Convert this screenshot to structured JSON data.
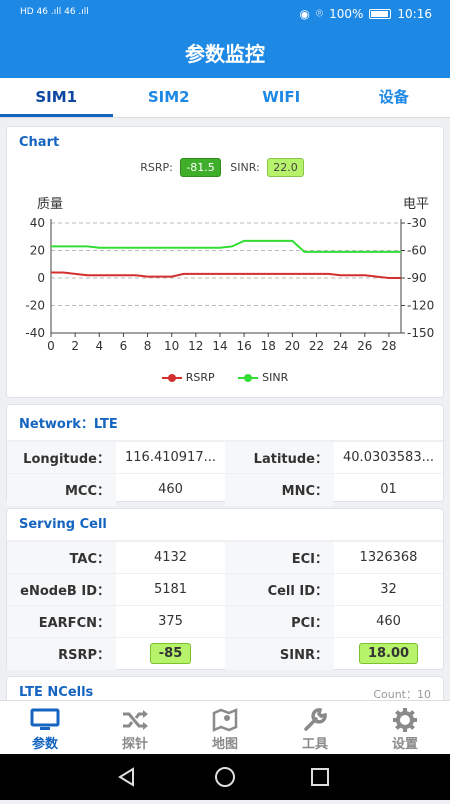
{
  "status": {
    "network_left": "HD 46 .ıll 46 .ıll",
    "battery": "100%",
    "time": "10:16"
  },
  "app": {
    "title": "参数监控"
  },
  "tabs": [
    {
      "label": "SIM1"
    },
    {
      "label": "SIM2"
    },
    {
      "label": "WIFI"
    },
    {
      "label": "设备"
    }
  ],
  "chart_section": {
    "title": "Chart",
    "rsrp_label": "RSRP:",
    "rsrp_value": "-81.5",
    "sinr_label": "SINR:",
    "sinr_value": "22.0",
    "left_axis_title": "质量",
    "right_axis_title": "电平"
  },
  "chart_data": {
    "type": "line",
    "x": [
      0,
      1,
      2,
      3,
      4,
      5,
      6,
      7,
      8,
      9,
      10,
      11,
      12,
      13,
      14,
      15,
      16,
      17,
      18,
      19,
      20,
      21,
      22,
      23,
      24,
      25,
      26,
      27,
      28,
      29
    ],
    "x_ticks": [
      0,
      2,
      4,
      6,
      8,
      10,
      12,
      14,
      16,
      18,
      20,
      22,
      24,
      26,
      28
    ],
    "y_left_ticks": [
      40,
      20,
      0,
      -20,
      -40
    ],
    "y_right_ticks": [
      -30,
      -60,
      -90,
      -120,
      -150
    ],
    "ylim_left": [
      -40,
      40
    ],
    "ylim_right": [
      -150,
      -30
    ],
    "series": [
      {
        "name": "RSRP",
        "color": "#d32f2f",
        "values": [
          4,
          4,
          3,
          2,
          2,
          2,
          2,
          2,
          1,
          1,
          1,
          3,
          3,
          3,
          3,
          3,
          3,
          3,
          3,
          3,
          3,
          3,
          3,
          3,
          2,
          2,
          2,
          1,
          0,
          0
        ]
      },
      {
        "name": "SINR",
        "color": "#33dd33",
        "values": [
          23,
          23,
          23,
          23,
          22,
          22,
          22,
          22,
          22,
          22,
          22,
          22,
          22,
          22,
          22,
          23,
          27,
          27,
          27,
          27,
          27,
          19,
          19,
          19,
          19,
          19,
          19,
          19,
          19,
          19
        ]
      }
    ],
    "grid": "dashed horizontal"
  },
  "network": {
    "title": "Network：LTE",
    "rows": [
      {
        "k1": "Longitude：",
        "v1": "116.410917...",
        "k2": "Latitude：",
        "v2": "40.0303583..."
      },
      {
        "k1": "MCC：",
        "v1": "460",
        "k2": "MNC：",
        "v2": "01"
      }
    ]
  },
  "serving": {
    "title": "Serving Cell",
    "rows": [
      {
        "k1": "TAC：",
        "v1": "4132",
        "k2": "ECI：",
        "v2": "1326368"
      },
      {
        "k1": "eNodeB ID：",
        "v1": "5181",
        "k2": "Cell ID：",
        "v2": "32"
      },
      {
        "k1": "EARFCN：",
        "v1": "375",
        "k2": "PCI：",
        "v2": "460"
      }
    ],
    "rsrp_label": "RSRP：",
    "rsrp_value": "-85",
    "sinr_label": "SINR：",
    "sinr_value": "18.00"
  },
  "ncells": {
    "title": "LTE NCells",
    "count": "Count：10"
  },
  "bottom_nav": [
    {
      "label": "参数",
      "icon": "monitor-icon"
    },
    {
      "label": "探针",
      "icon": "shuffle-icon"
    },
    {
      "label": "地图",
      "icon": "map-icon"
    },
    {
      "label": "工具",
      "icon": "wrench-icon"
    },
    {
      "label": "设置",
      "icon": "gear-icon"
    }
  ]
}
